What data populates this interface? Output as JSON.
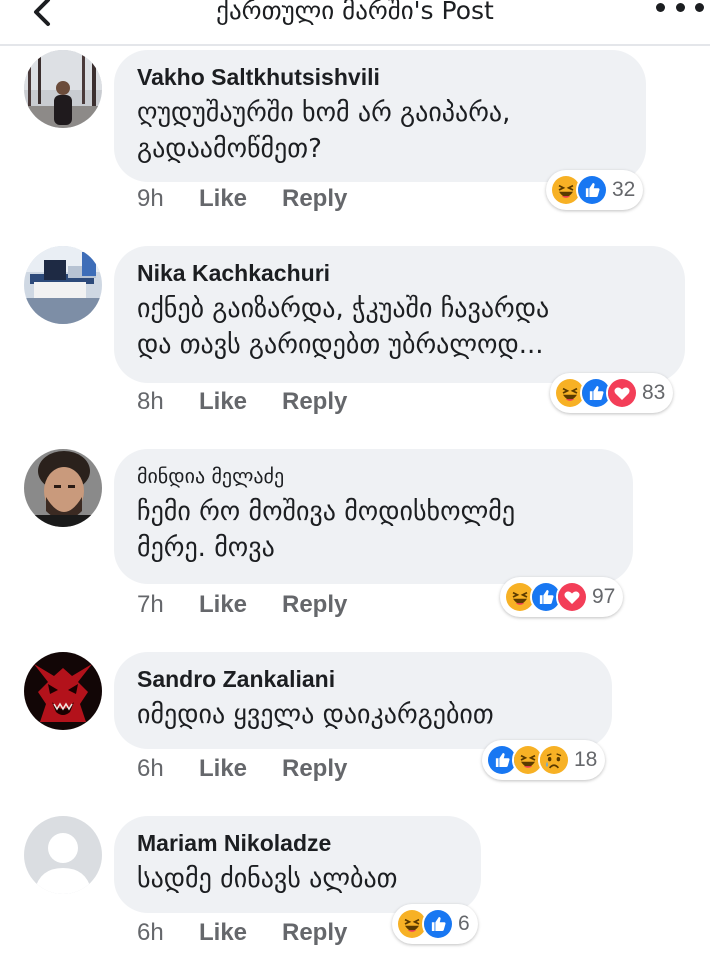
{
  "header": {
    "title": "ქართული მარში's Post",
    "back_icon": "chevron-left-icon",
    "more_icon": "more-dots-icon"
  },
  "actions": {
    "like_label": "Like",
    "reply_label": "Reply"
  },
  "colors": {
    "bubble": "#eff1f4",
    "like_blue": "#1877f2",
    "love_red": "#f33e58",
    "haha_yellow": "#f7b125",
    "meta_gray": "#65676b"
  },
  "comments": [
    {
      "author": "Vakho Saltkhutsishvili",
      "lines": [
        "ღუდუშაურში ხომ არ გაიპარა,",
        "გადაამოწმეთ?"
      ],
      "time": "9h",
      "reactions": [
        "haha",
        "like"
      ],
      "reaction_count": "32"
    },
    {
      "author": "Nika Kachkachuri",
      "lines": [
        "იქნებ გაიზარდა, ჭკუაში ჩავარდა",
        "და თავს გარიდებთ უბრალოდ..."
      ],
      "time": "8h",
      "reactions": [
        "haha",
        "like",
        "love"
      ],
      "reaction_count": "83"
    },
    {
      "author": "მინდია მელაძე",
      "lines": [
        "ჩემი რო მოშივა მოდისხოლმე",
        "მერე. მოვა"
      ],
      "time": "7h",
      "reactions": [
        "haha",
        "like",
        "love"
      ],
      "reaction_count": "97"
    },
    {
      "author": "Sandro Zankaliani",
      "lines": [
        "იმედია ყველა დაიკარგებით"
      ],
      "time": "6h",
      "reactions": [
        "like",
        "haha",
        "sad"
      ],
      "reaction_count": "18"
    },
    {
      "author": "Mariam Nikoladze",
      "lines": [
        "სადმე ძინავს ალბათ"
      ],
      "time": "6h",
      "reactions": [
        "haha",
        "like"
      ],
      "reaction_count": "6"
    }
  ]
}
